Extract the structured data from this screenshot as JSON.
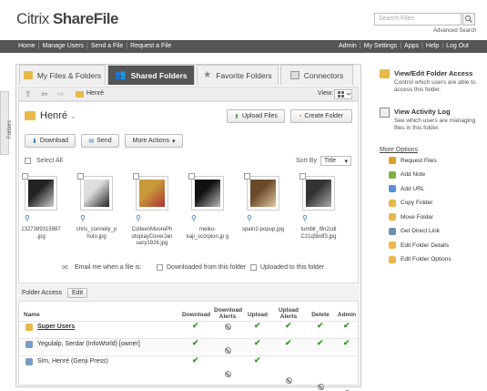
{
  "brand": {
    "name_light": "Citrix ",
    "name_bold": "ShareFile"
  },
  "search": {
    "placeholder": "Search Files",
    "advanced": "Advanced Search"
  },
  "topnav": {
    "left": [
      "Home",
      "Manage Users",
      "Send a File",
      "Request a File"
    ],
    "right": [
      "Admin",
      "My Settings",
      "Apps",
      "Help",
      "Log Out"
    ]
  },
  "rail_label": "Folders",
  "tabs": [
    {
      "label": "My Files & Folders",
      "icon": "folder-icon",
      "active": false
    },
    {
      "label": "Shared Folders",
      "icon": "shared-users-icon",
      "active": true
    },
    {
      "label": "Favorite Folders",
      "icon": "star-icon",
      "active": false
    },
    {
      "label": "Connectors",
      "icon": "connectors-icon",
      "active": false
    }
  ],
  "toolbar": {
    "breadcrumb": "Henré",
    "view_label": "View:"
  },
  "folder": {
    "title": "Henré",
    "upload_files": "Upload Files",
    "create_folder": "Create Folder",
    "download": "Download",
    "send": "Send",
    "more_actions": "More Actions",
    "select_all": "Select All",
    "sort_by": "Sort By",
    "sort_value": "Title"
  },
  "files": [
    {
      "name": "1327389315987 .jpg",
      "colors": [
        "#222",
        "#ccc"
      ]
    },
    {
      "name": "chris_connelly_p hoto.jpg",
      "colors": [
        "#ddd",
        "#222"
      ]
    },
    {
      "name": "ColleenMoorePh otoplayCoverJan uary1926.jpg",
      "colors": [
        "#c99a3a",
        "#a33"
      ]
    },
    {
      "name": "meiko-kaji_scorpion.jp g",
      "colors": [
        "#111",
        "#bbb"
      ]
    },
    {
      "name": "spain2-popup.jpg",
      "colors": [
        "#6b4a2a",
        "#e0c8a0"
      ]
    },
    {
      "name": "tumblr_l9n2cdi C21q5bdf3.jpg",
      "colors": [
        "#333",
        "#aaa"
      ]
    }
  ],
  "email": {
    "label": "Email me when a file is:",
    "opt1": "Downloaded from this folder",
    "opt2": "Uploaded to this folder"
  },
  "access": {
    "title": "Folder Access",
    "edit": "Edit",
    "headers": [
      "Name",
      "Download",
      "Download Alerts",
      "Upload",
      "Upload Alerts",
      "Delete",
      "Admin"
    ],
    "rows": [
      {
        "name": "Super Users",
        "bold": true,
        "perms": [
          true,
          false,
          true,
          true,
          true,
          true
        ]
      },
      {
        "name": "Yegulalp, Serdar (InfoWorld) [owner]",
        "bold": false,
        "perms": [
          true,
          false,
          true,
          true,
          true,
          true
        ]
      },
      {
        "name": "Sim, Henré (Genji Press)",
        "bold": false,
        "perms": [
          true,
          false,
          true,
          false,
          false,
          false
        ]
      }
    ]
  },
  "side": {
    "view_edit": {
      "title": "View/Edit Folder Access",
      "desc": "Control which users are able to access this folder."
    },
    "activity": {
      "title": "View Activity Log",
      "desc": "See which users are managing files in this folder."
    },
    "more_options": "More Options",
    "options": [
      {
        "label": "Request Files",
        "color": "#e0a020"
      },
      {
        "label": "Add Note",
        "color": "#7cb342"
      },
      {
        "label": "Add URL",
        "color": "#5b8fd6"
      },
      {
        "label": "Copy Folder",
        "color": "#e8b84a"
      },
      {
        "label": "Move Folder",
        "color": "#e8b84a"
      },
      {
        "label": "Get Direct Link",
        "color": "#6c8fb8"
      },
      {
        "label": "Edit Folder Details",
        "color": "#e8b84a"
      },
      {
        "label": "Edit Folder Options",
        "color": "#e8b84a"
      }
    ]
  }
}
